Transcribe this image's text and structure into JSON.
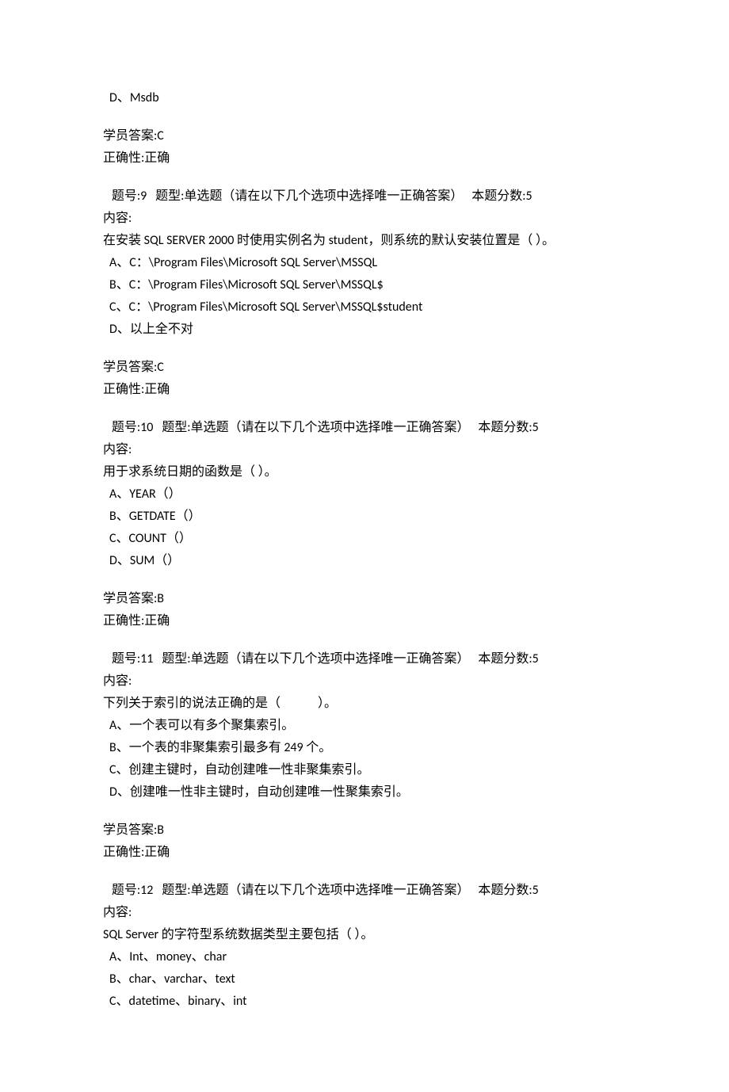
{
  "q8_partial": {
    "option_d": "D、Msdb",
    "student_answer_label": "学员答案:C",
    "correctness_label": "正确性:正确"
  },
  "q9": {
    "header": "   题号:9   题型:单选题（请在以下几个选项中选择唯一正确答案）   本题分数:5",
    "content_label": "内容:",
    "stem": "在安装 SQL SERVER 2000 时使用实例名为 student，则系统的默认安装位置是（ ）。",
    "option_a": "A、C：\\Program Files\\Microsoft SQL Server\\MSSQL",
    "option_b": "B、C：\\Program Files\\Microsoft SQL Server\\MSSQL$",
    "option_c": "C、C：\\Program Files\\Microsoft SQL Server\\MSSQL$student",
    "option_d": "D、以上全不对",
    "student_answer_label": "学员答案:C",
    "correctness_label": "正确性:正确"
  },
  "q10": {
    "header": "   题号:10   题型:单选题（请在以下几个选项中选择唯一正确答案）   本题分数:5",
    "content_label": "内容:",
    "stem": "用于求系统日期的函数是（ ）。",
    "option_a": "A、YEAR（）",
    "option_b": "B、GETDATE（）",
    "option_c": "C、COUNT（）",
    "option_d": "D、SUM（）",
    "student_answer_label": "学员答案:B",
    "correctness_label": "正确性:正确"
  },
  "q11": {
    "header": "   题号:11   题型:单选题（请在以下几个选项中选择唯一正确答案）   本题分数:5",
    "content_label": "内容:",
    "stem": "下列关于索引的说法正确的是（             ）。",
    "option_a": "A、一个表可以有多个聚集索引。",
    "option_b": "B、一个表的非聚集索引最多有 249 个。",
    "option_c": "C、创建主键时，自动创建唯一性非聚集索引。",
    "option_d": "D、创建唯一性非主键时，自动创建唯一性聚集索引。",
    "student_answer_label": "学员答案:B",
    "correctness_label": "正确性:正确"
  },
  "q12": {
    "header": "   题号:12   题型:单选题（请在以下几个选项中选择唯一正确答案）   本题分数:5",
    "content_label": "内容:",
    "stem": "SQL Server 的字符型系统数据类型主要包括（ ）。",
    "option_a": "A、Int、money、char",
    "option_b": "B、char、varchar、text",
    "option_c": "C、datetime、binary、int"
  }
}
